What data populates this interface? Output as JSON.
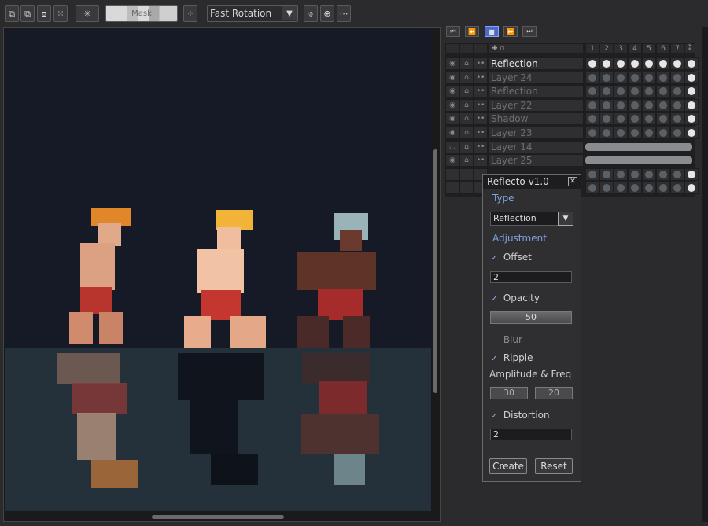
{
  "toolbar": {
    "mask_label": "Mask",
    "rotation_mode": "Fast Rotation"
  },
  "layers": {
    "frame_numbers": [
      "1",
      "2",
      "3",
      "4",
      "5",
      "6",
      "7"
    ],
    "rows": [
      {
        "name": "Reflection",
        "active": true,
        "visible": true
      },
      {
        "name": "Layer 24",
        "visible": true
      },
      {
        "name": "Reflection",
        "visible": true
      },
      {
        "name": "Layer 22",
        "visible": true
      },
      {
        "name": "Shadow",
        "visible": true
      },
      {
        "name": "Layer 23",
        "visible": true
      },
      {
        "name": "Layer 14",
        "visible": false,
        "bar": true
      },
      {
        "name": "Layer 25",
        "visible": true,
        "bar": true
      }
    ]
  },
  "dialog": {
    "title": "Reflecto v1.0",
    "type_section": "Type",
    "type_value": "Reflection",
    "adjustment_section": "Adjustment",
    "offset_label": "Offset",
    "offset_value": "2",
    "opacity_label": "Opacity",
    "opacity_value": "50",
    "blur_label": "Blur",
    "ripple_label": "Ripple",
    "amp_freq_label": "Amplitude & Freq",
    "amplitude_value": "30",
    "frequency_value": "20",
    "distortion_label": "Distortion",
    "distortion_value": "2",
    "create_label": "Create",
    "reset_label": "Reset"
  },
  "colors": {
    "accent": "#7fa3e0",
    "canvas_bg": "#151a26",
    "water": "#24303a"
  }
}
